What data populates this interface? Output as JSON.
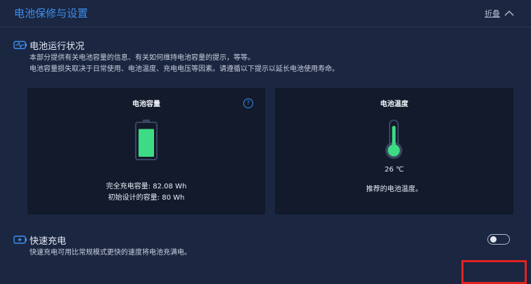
{
  "header": {
    "title": "电池保修与设置",
    "collapse_label": "折叠"
  },
  "battery_status": {
    "title": "电池运行状况",
    "desc1": "本部分提供有关电池容量的信息、有关如何维持电池容量的提示，等等。",
    "desc2": "电池容量损失取决于日常使用、电池温度、充电电压等因素。请遵循以下提示以延长电池使用寿命。",
    "capacity_card": {
      "title": "电池容量",
      "help": "?",
      "full_charge": "完全充电容量:  82.08 Wh",
      "design": "初始设计的容量:  80 Wh",
      "level": 0.92
    },
    "temperature_card": {
      "title": "电池温度",
      "value": "26 ℃",
      "note": "推荐的电池温度。"
    }
  },
  "fast_charge": {
    "title": "快速充电",
    "desc": "快速充电可用比常规模式更快的速度将电池充满电。",
    "enabled": false
  },
  "colors": {
    "accent": "#3b8ff0",
    "battery_green": "#3ddc84",
    "highlight_red": "#e32222"
  }
}
